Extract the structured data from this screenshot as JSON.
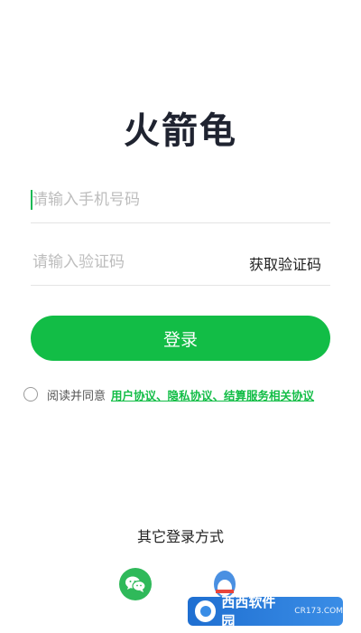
{
  "app": {
    "title": "火箭龟"
  },
  "form": {
    "phone_placeholder": "请输入手机号码",
    "code_placeholder": "请输入验证码",
    "get_code_label": "获取验证码",
    "login_label": "登录"
  },
  "agreement": {
    "prefix": "阅读并同意",
    "links": "用户协议、隐私协议、结算服务相关协议"
  },
  "other_login": {
    "label": "其它登录方式",
    "icons": [
      "wechat-icon",
      "qq-icon"
    ]
  },
  "watermark": {
    "text": "西西软件园",
    "sub": "CR173.COM"
  },
  "colors": {
    "accent": "#12bd46",
    "title": "#1f2330",
    "qq": "#4a90e2"
  }
}
